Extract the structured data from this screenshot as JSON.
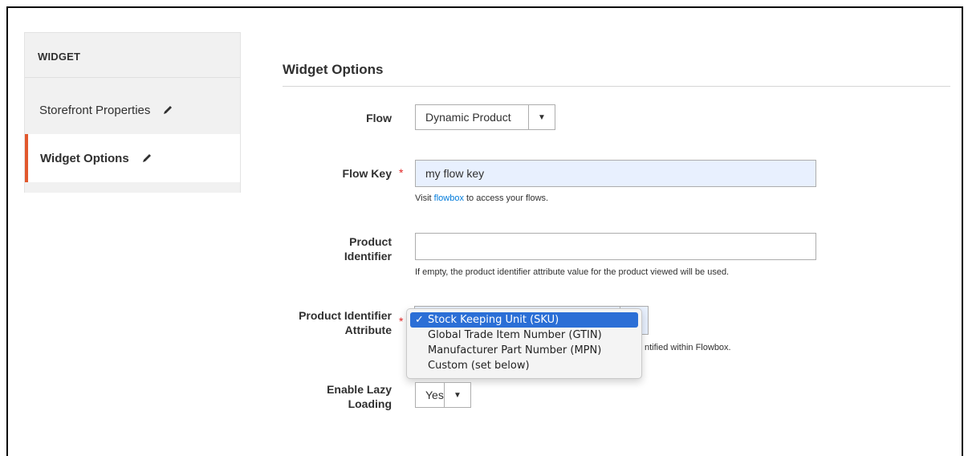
{
  "sidebar": {
    "title": "WIDGET",
    "items": [
      {
        "label": "Storefront Properties",
        "icon": "pencil-icon"
      },
      {
        "label": "Widget Options",
        "icon": "pencil-icon",
        "active": true
      }
    ]
  },
  "section": {
    "title": "Widget Options"
  },
  "fields": {
    "flow": {
      "label": "Flow",
      "value": "Dynamic Product"
    },
    "flow_key": {
      "label": "Flow Key",
      "value": "my flow key",
      "note_prefix": "Visit ",
      "note_link": "flowbox",
      "note_suffix": " to access your flows."
    },
    "product_identifier": {
      "label_line1": "Product",
      "label_line2": "Identifier",
      "value": "",
      "note": "If empty, the product identifier attribute value for the product viewed will be used."
    },
    "product_identifier_attribute": {
      "label_line1": "Product Identifier",
      "label_line2": "Attribute",
      "note_visible": "ntified within Flowbox.",
      "options": [
        "Stock Keeping Unit (SKU)",
        "Global Trade Item Number (GTIN)",
        "Manufacturer Part Number (MPN)",
        "Custom (set below)"
      ],
      "selected": "Stock Keeping Unit (SKU)"
    },
    "lazy_loading": {
      "label_line1": "Enable Lazy",
      "label_line2": "Loading",
      "value": "Yes"
    }
  },
  "colors": {
    "accent": "#e2582d",
    "required": "#e22626",
    "link": "#007bdb",
    "highlight": "#2b6fd6"
  }
}
